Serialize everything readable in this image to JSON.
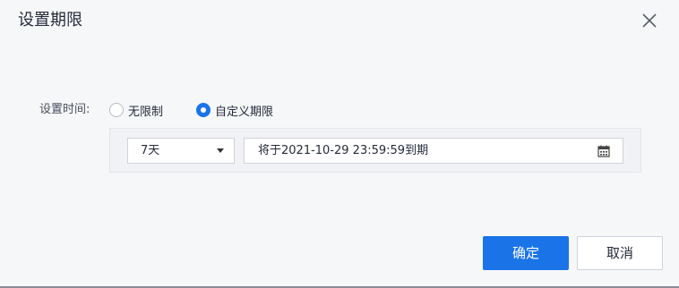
{
  "dialog": {
    "title": "设置期限",
    "close_icon": "close-icon"
  },
  "form": {
    "time_label": "设置时间:",
    "options": [
      {
        "label": "无限制",
        "checked": false
      },
      {
        "label": "自定义期限",
        "checked": true
      }
    ],
    "duration": {
      "selected": "7天",
      "icon": "chevron-down-icon"
    },
    "expiry": {
      "text": "将于2021-10-29 23:59:59到期",
      "icon": "calendar-icon"
    }
  },
  "footer": {
    "ok_label": "确定",
    "cancel_label": "取消"
  },
  "colors": {
    "accent": "#1a74e8",
    "background": "#f6f7f9"
  }
}
